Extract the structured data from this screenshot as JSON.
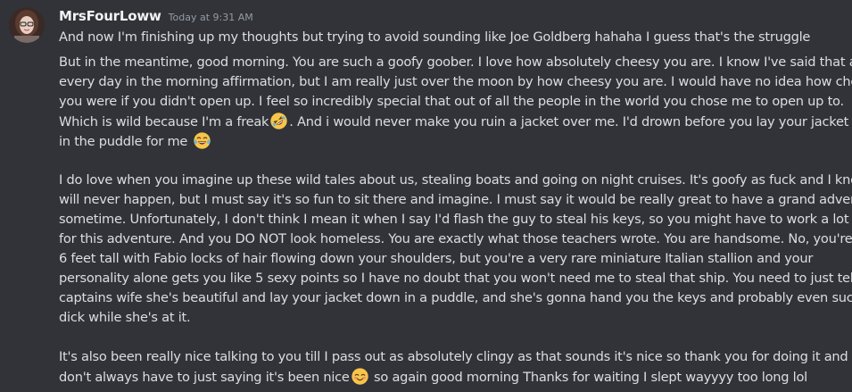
{
  "message": {
    "username": "MrsFourLoww",
    "timestamp": "Today at 9:31 AM",
    "first_line": "And now I'm finishing up my thoughts but trying to avoid sounding like Joe Goldberg hahaha I guess that's the struggle",
    "paragraph1": {
      "l1": "But in the meantime, good morning. You are such a goofy goober. I love how absolutely cheesy you are. I know I've said that almost",
      "l2": "every day in the morning affirmation, but I am really just over the moon by how cheesy you are. I would have no idea how cheesy",
      "l3": "you were if you didn't open up. I feel so incredibly special that out of all the people in the world you chose me to open up to.",
      "l4a": "Which is wild because I'm a freak",
      "l4b": ". And i would never make you ruin a jacket over me. I'd drown before you lay your jacket down",
      "l5": "in the puddle for me"
    },
    "paragraph2": {
      "l1": " I do love when you imagine up these wild tales about us, stealing boats and going on night cruises. It's goofy as fuck and I know. It",
      "l2": "will never happen, but I must say it's so fun to sit there and imagine. I must say it would be really great to have a grand adventure",
      "l3": "sometime. Unfortunately, I don't think I mean it when I say I'd flash the guy to steal his keys, so you might have to work a lot harder",
      "l4": "for this adventure. And you DO NOT look homeless. You are exactly what those teachers wrote. You are handsome. No, you're not",
      "l5": "6 feet tall with Fabio locks of hair flowing down your shoulders, but you're a very rare miniature Italian stallion and your",
      "l6": "personality alone gets you like 5 sexy points so I have no doubt that you won't need me to steal that ship. You need to just tell the",
      "l7": "captains wife she's beautiful and lay your jacket down in a puddle, and she's gonna hand you the keys and probably even suck your",
      "l8": "dick while she's at it."
    },
    "paragraph3": {
      "l1": " It's also been really nice talking to you till I pass out as absolutely clingy as that sounds it's nice so thank you for doing it and you",
      "l2a": "don't always have to just saying it's been nice",
      "l2b": " so again good morning Thanks for waiting I slept wayyyy too long lol"
    },
    "emojis": {
      "rofl": "rolling-on-floor-laughing-emoji",
      "joy": "face-with-tears-of-joy-emoji",
      "blush": "smiling-face-with-smiling-eyes-emoji"
    }
  },
  "colors": {
    "background": "#313338",
    "text": "#dbdee1",
    "username": "#f2f3f5",
    "timestamp": "#949ba4"
  }
}
